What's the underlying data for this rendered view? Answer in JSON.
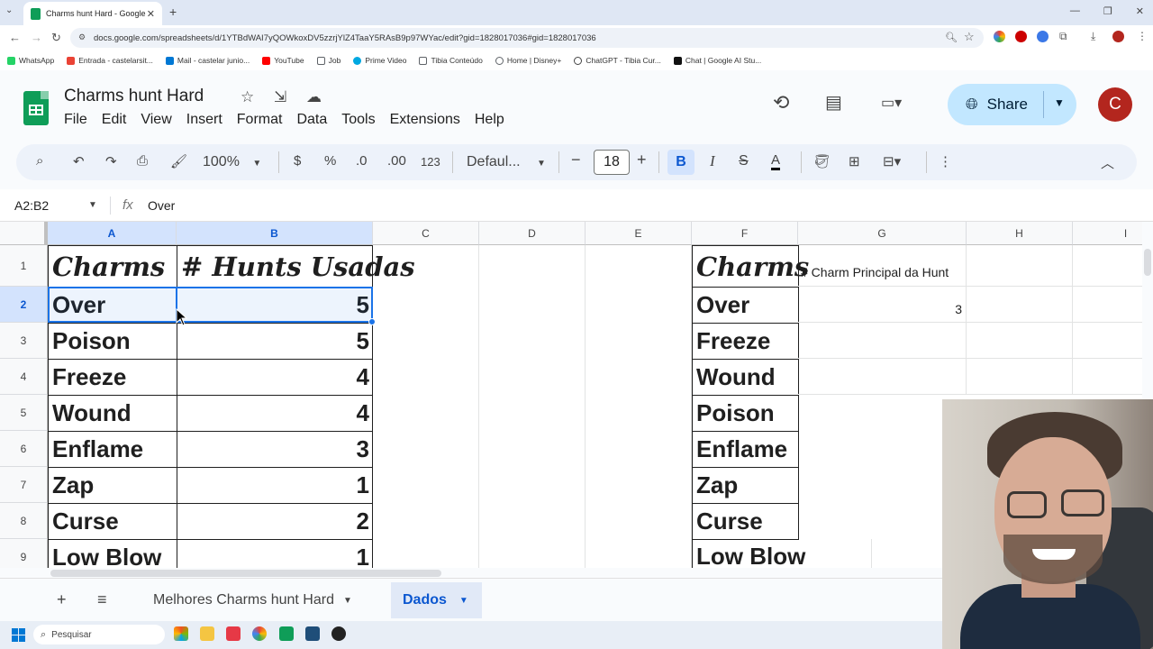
{
  "browser": {
    "tab_title": "Charms hunt Hard - Google Sh",
    "url": "docs.google.com/spreadsheets/d/1YTBdWAI7yQOWkoxDV5zzrjYlZ4TaaY5RAsB9p97WYac/edit?gid=1828017036#gid=1828017036",
    "bookmarks": [
      {
        "label": "WhatsApp",
        "color": "#25d366"
      },
      {
        "label": "Entrada - castelarsit...",
        "color": "#ea4335"
      },
      {
        "label": "Mail - castelar junio...",
        "color": "#0078d4"
      },
      {
        "label": "YouTube",
        "color": "#ff0000"
      },
      {
        "label": "Job",
        "color": "#5f6368"
      },
      {
        "label": "Prime Video",
        "color": "#00a8e1"
      },
      {
        "label": "Tibia Conteúdo",
        "color": "#5f6368"
      },
      {
        "label": "Home | Disney+",
        "color": "#113ccf"
      },
      {
        "label": "ChatGPT - Tibia Cur...",
        "color": "#444444"
      },
      {
        "label": "Chat | Google AI Stu...",
        "color": "#111111"
      }
    ]
  },
  "sheets": {
    "doc_title": "Charms hunt Hard",
    "menu": [
      "File",
      "Edit",
      "View",
      "Insert",
      "Format",
      "Data",
      "Tools",
      "Extensions",
      "Help"
    ],
    "share_label": "Share",
    "avatar_letter": "C",
    "toolbar": {
      "zoom": "100%",
      "currency": "$",
      "percent": "%",
      "dec_decrease": ".0",
      "dec_increase": ".00",
      "number_format": "123",
      "font": "Defaul...",
      "font_size": "18",
      "bold": "B",
      "italic": "I"
    },
    "name_box": "A2:B2",
    "formula_value": "Over",
    "columns": [
      "A",
      "B",
      "C",
      "D",
      "E",
      "F",
      "G",
      "H",
      "I"
    ],
    "rows": [
      "1",
      "2",
      "3",
      "4",
      "5",
      "6",
      "7",
      "8",
      "9"
    ],
    "table_left": {
      "header": [
        "Charms",
        "# Hunts Usadas"
      ],
      "rows": [
        [
          "Over",
          "5"
        ],
        [
          "Poison",
          "5"
        ],
        [
          "Freeze",
          "4"
        ],
        [
          "Wound",
          "4"
        ],
        [
          "Enflame",
          "3"
        ],
        [
          "Zap",
          "1"
        ],
        [
          "Curse",
          "2"
        ],
        [
          "Low Blow",
          "1"
        ]
      ]
    },
    "table_right": {
      "header": [
        "Charms",
        "# Charm Principal da Hunt"
      ],
      "charms": [
        "Over",
        "Freeze",
        "Wound",
        "Poison",
        "Enflame",
        "Zap",
        "Curse",
        "Low Blow"
      ],
      "g2_value": "3"
    },
    "sheet_tabs": [
      "Melhores Charms hunt Hard",
      "Dados"
    ],
    "active_tab": "Dados"
  },
  "taskbar": {
    "search_placeholder": "Pesquisar"
  }
}
